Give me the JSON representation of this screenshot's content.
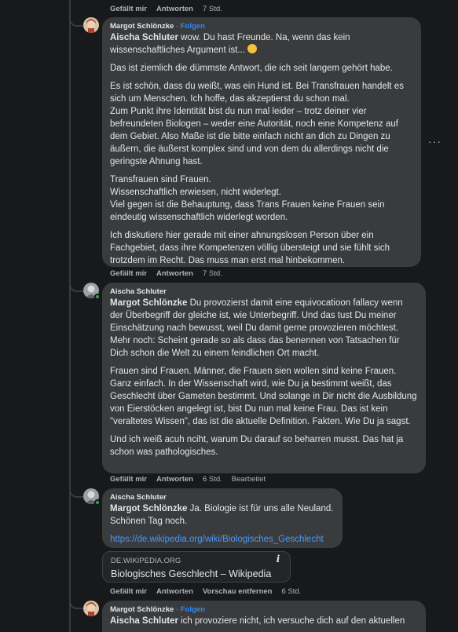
{
  "thread": {
    "top_actions": {
      "like": "Gefällt mir",
      "reply": "Antworten",
      "time": "7 Std."
    },
    "comments": [
      {
        "author": "Margot Schlönzke",
        "separator": "·",
        "follow": "Folgen",
        "mention": "Aischa Schluter",
        "first_line": "wow. Du hast Freunde. Na, wenn das kein wissenschaftliches Argument ist...",
        "emoji": "rolling-eyes-emoji",
        "p2": "Das ist ziemlich die dümmste Antwort, die ich seit langem gehört habe.",
        "p3": "Es ist schön, dass du weißt, was ein Hund ist. Bei Transfrauen handelt es sich um Menschen. Ich hoffe, das akzeptierst du schon mal.",
        "p3b": "Zum Punkt ihre Identität bist du nun mal leider – trotz deiner vier befreundeten Biologen – weder eine Autorität, noch eine Kompetenz auf dem Gebiet. Also Maße ist die bitte einfach nicht an dich zu Dingen zu äußern, die äußerst komplex sind und von dem du allerdings nicht die geringste Ahnung hast.",
        "p4a": "Transfrauen sind Frauen.",
        "p4b": "Wissenschaftlich erwiesen, nicht widerlegt.",
        "p4c": "Viel gegen ist die Behauptung, dass Trans Frauen keine Frauen sein eindeutig wissenschaftlich widerlegt worden.",
        "p5": "Ich diskutiere hier gerade mit einer ahnungslosen Person über ein Fachgebiet, dass ihre Kompetenzen völlig übersteigt und sie fühlt sich trotzdem im Recht. Das muss man erst mal hinbekommen.",
        "actions": {
          "like": "Gefällt mir",
          "reply": "Antworten",
          "time": "7 Std."
        }
      },
      {
        "author": "Aischa Schluter",
        "mention": "Margot Schlönzke",
        "p1": "Du provozierst damit eine equivocatioon fallacy wenn der Überbegriff der gleiche ist, wie Unterbegriff. Und das tust Du meiner Einschätzung nach bewusst, weil Du damit gerne provozieren möchtest. Mehr noch: Scheint gerade so als dass das benennen von Tatsachen für Dich schon die Welt zu einem feindlichen Ort macht.",
        "p2": "Frauen sind Frauen. Männer, die Frauen sien wollen sind keine Frauen. Ganz einfach. In der Wissenschaft wird, wie Du ja bestimmt weißt, das Geschlecht über Gameten bestimmt. Und solange in Dir nicht die Ausbildung von Eierstöcken angelegt ist, bist Du nun mal keine Frau. Das ist kein \"veraltetes Wissen\", das ist die aktuelle Definition. Fakten. Wie Du ja sagst.",
        "p3": "Und ich weiß acuh nciht, warum Du darauf so beharren musst. Das hat ja schon was pathologisches.",
        "actions": {
          "like": "Gefällt mir",
          "reply": "Antworten",
          "time": "6 Std.",
          "edited": "Bearbeitet"
        }
      },
      {
        "author": "Aischa Schluter",
        "mention": "Margot Schlönzke",
        "p1": "Ja. Biologie ist für uns alle Neuland. Schönen Tag noch.",
        "link": "https://de.wikipedia.org/wiki/Biologisches_Geschlecht",
        "preview": {
          "domain": "DE.WIKIPEDIA.ORG",
          "title": "Biologisches Geschlecht – Wikipedia",
          "info": "i"
        },
        "actions": {
          "like": "Gefällt mir",
          "reply": "Antworten",
          "remove_preview": "Vorschau entfernen",
          "time": "6 Std."
        }
      },
      {
        "author": "Margot Schlönzke",
        "separator": "·",
        "follow": "Folgen",
        "mention": "Aischa Schluter",
        "p1": "ich provoziere nicht, ich versuche dich auf den aktuellen"
      }
    ],
    "more_menu": "···",
    "colors": {
      "background": "#18191a",
      "bubble": "#3a3b3c",
      "link": "#4599ff",
      "follow": "#2d88ff",
      "online": "#31a24c"
    }
  }
}
